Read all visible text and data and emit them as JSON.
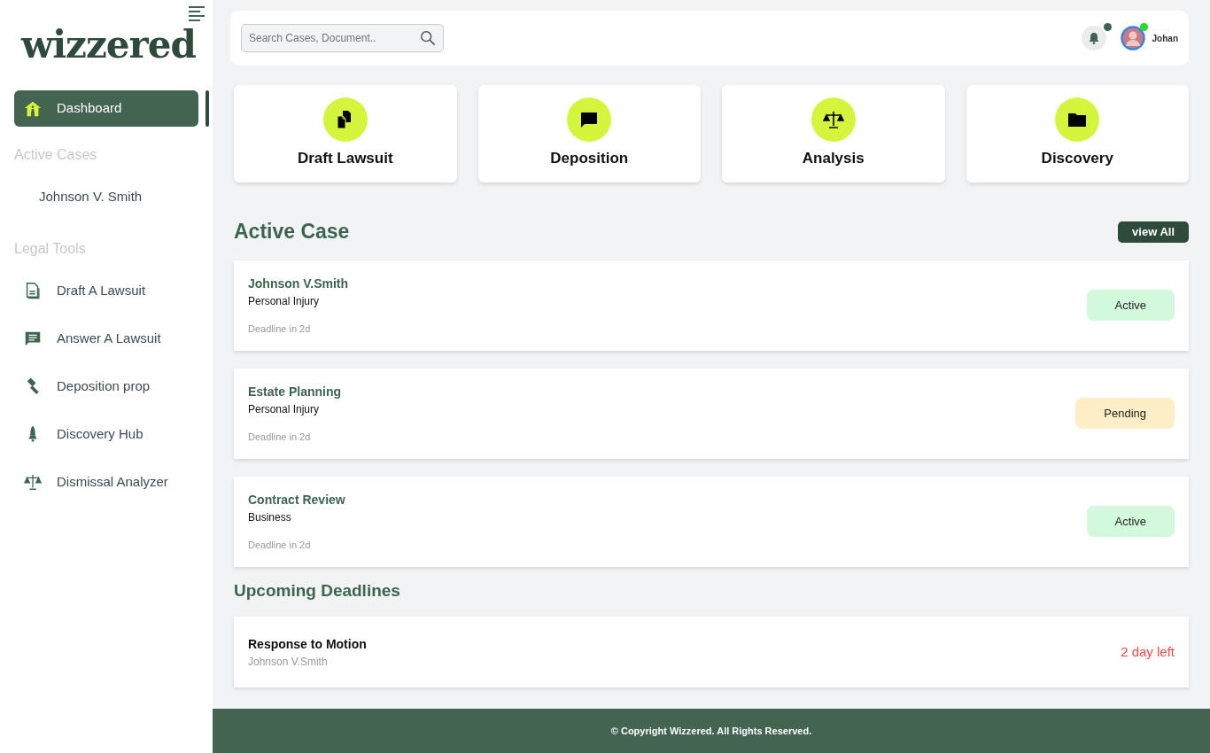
{
  "sidebar": {
    "logo": "wizzered",
    "primary": [
      {
        "label": "Dashboard",
        "kind": "home",
        "selected": true
      }
    ],
    "sections": [
      {
        "title": "Active Cases",
        "items": [
          {
            "label": "Johnson V. Smith",
            "kind": "none",
            "selected": false
          }
        ]
      },
      {
        "title": "Legal Tools",
        "items": [
          {
            "label": "Draft A Lawsuit",
            "kind": "document",
            "selected": false
          },
          {
            "label": "Answer A Lawsuit",
            "kind": "chat",
            "selected": false
          },
          {
            "label": "Deposition prop",
            "kind": "gavel",
            "selected": false
          },
          {
            "label": "Discovery Hub",
            "kind": "rocket",
            "selected": false
          },
          {
            "label": "Dismissal Analyzer",
            "kind": "scales",
            "selected": false
          }
        ]
      }
    ]
  },
  "topbar": {
    "search": {
      "placeholder": "Search Cases, Document.."
    },
    "notifications": {
      "unread": true
    },
    "user": {
      "name": "Johan",
      "online": true
    }
  },
  "tools": [
    {
      "label": "Draft Lawsuit",
      "kind": "documents"
    },
    {
      "label": "Deposition",
      "kind": "chat"
    },
    {
      "label": "Analysis",
      "kind": "scales"
    },
    {
      "label": "Discovery",
      "kind": "folder"
    }
  ],
  "active_cases": {
    "title": "Active Case",
    "view_all": "view All",
    "cases": [
      {
        "name": "Johnson V.Smith",
        "type": "Personal Injury",
        "deadline": "Deadline in 2d",
        "status": {
          "label": "Active",
          "kind": "active"
        }
      },
      {
        "name": "Estate Planning",
        "type": "Personal Injury",
        "deadline": "Deadline in 2d",
        "status": {
          "label": "Pending",
          "kind": "pending"
        }
      },
      {
        "name": "Contract Review",
        "type": "Business",
        "deadline": "Deadline in 2d",
        "status": {
          "label": "Active",
          "kind": "active"
        }
      }
    ]
  },
  "deadlines": {
    "title": "Upcoming Deadlines",
    "items": [
      {
        "title": "Response to Motion",
        "case": "Johnson V.Smith",
        "remaining": "2 day left"
      }
    ]
  },
  "footer": "© Copyright Wizzered. All Rights Reserved."
}
